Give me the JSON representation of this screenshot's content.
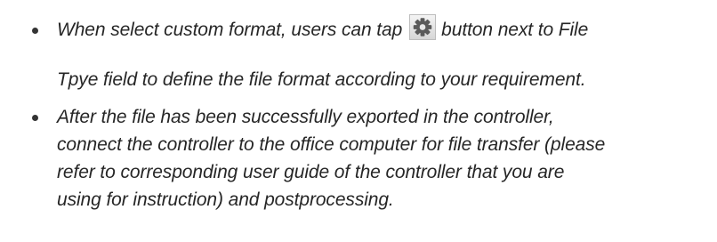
{
  "bullets": [
    {
      "lines": [
        "When select custom format, users can tap",
        "button next to File",
        "Tpye field to define the file format according to your requirement."
      ],
      "icon": "gear-icon"
    },
    {
      "lines": [
        "After the file has been successfully exported in the controller,",
        "connect the controller to the office computer for file transfer (please",
        "refer to corresponding user guide of the controller that you are",
        "using for instruction) and postprocessing."
      ]
    }
  ]
}
